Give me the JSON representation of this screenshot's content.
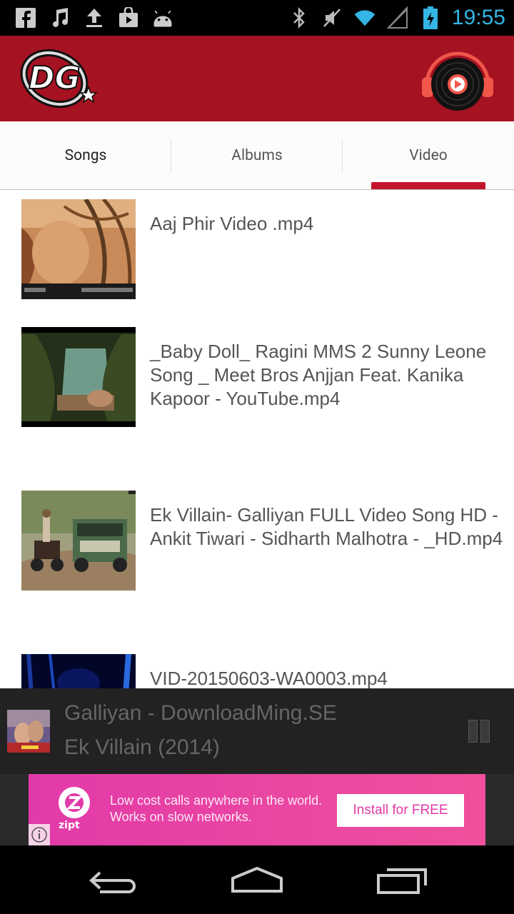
{
  "status_bar": {
    "time": "19:55",
    "left_icons": [
      "facebook-icon",
      "music-note-icon",
      "upload-icon",
      "shopping-bag-icon",
      "android-icon"
    ],
    "right_icons": [
      "bluetooth-icon",
      "mute-icon",
      "wifi-icon",
      "signal-icon",
      "battery-icon"
    ],
    "time_color": "#33b5e5"
  },
  "app_bar": {
    "logo_text": "DG",
    "background": "#a51221"
  },
  "tabs": [
    {
      "label": "Songs"
    },
    {
      "label": "Albums"
    },
    {
      "label": "Video",
      "selected": true
    }
  ],
  "videos": [
    {
      "title": "Aaj Phir Video .mp4"
    },
    {
      "title": "_Baby Doll_ Ragini MMS 2 Sunny Leone Song _ Meet Bros Anjjan Feat. Kanika Kapoor - YouTube.mp4"
    },
    {
      "title": "Ek Villain- Galliyan    FULL Video Song HD - Ankit Tiwari - Sidharth Malhotra - _HD.mp4"
    },
    {
      "title": "VID-20150603-WA0003.mp4"
    }
  ],
  "now_playing": {
    "title": "Galliyan - DownloadMing.SE",
    "subtitle": "Ek Villain (2014)"
  },
  "ad": {
    "brand": "zipt",
    "text": "Low cost calls anywhere in the world. Works on slow networks.",
    "button": "Install for FREE"
  },
  "accent_color": "#c4162b"
}
